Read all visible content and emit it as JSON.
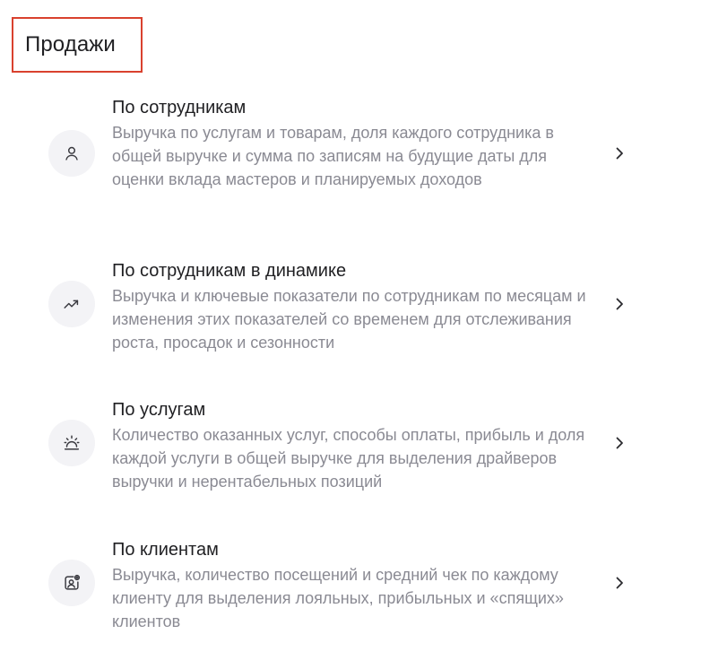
{
  "section": {
    "title": "Продажи"
  },
  "reports": [
    {
      "title": "По сотрудникам",
      "description": "Выручка по услугам и товарам, доля каждого сотрудника в общей выручке и сумма по записям на будущие даты для оценки вклада мастеров и планируемых доходов",
      "icon": "person-icon"
    },
    {
      "title": "По сотрудникам в динамике",
      "description": "Выручка и ключевые показатели по сотрудникам по месяцам и изменения этих показателей со временем для отслеживания роста, просадок и сезонности",
      "icon": "trending-up-icon"
    },
    {
      "title": "По услугам",
      "description": "Количество оказанных услуг, способы оплаты, прибыль и доля каждой услуги в общей выручке для выделения драйверов выручки и нерентабельных позиций",
      "icon": "service-bell-icon"
    },
    {
      "title": "По клиентам",
      "description": "Выручка, количество посещений и средний чек по каждому клиенту для выделения лояльных, прибыльных и «спящих» клиентов",
      "icon": "client-card-icon"
    }
  ],
  "colors": {
    "highlight_border": "#d9412e",
    "title_text": "#1f1f22",
    "description_text": "#8a8a93",
    "icon_background": "#f3f3f6"
  }
}
